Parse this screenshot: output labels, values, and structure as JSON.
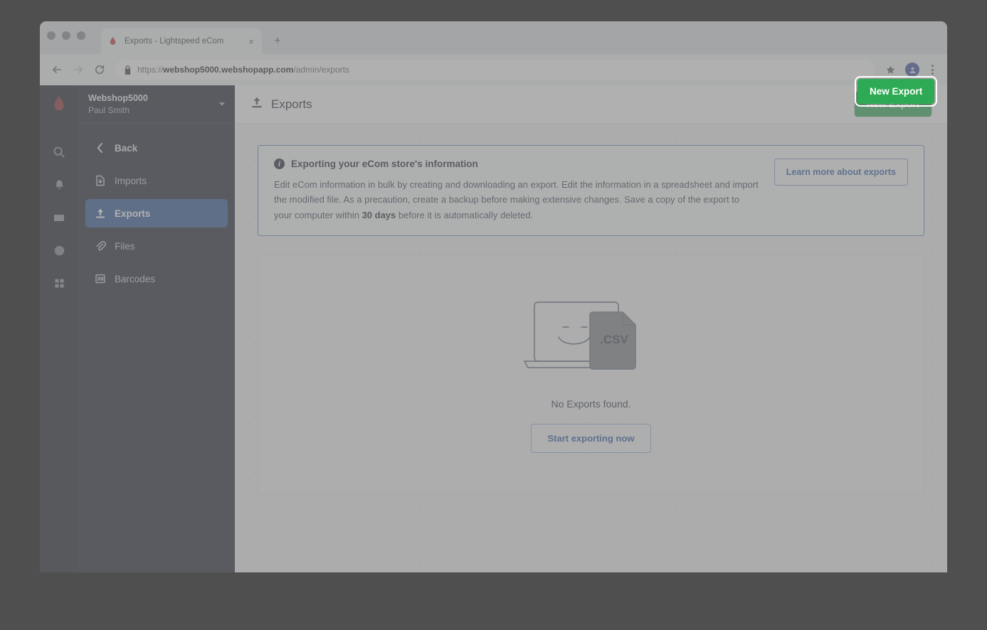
{
  "browser": {
    "window_buttons": [
      "close",
      "minimize",
      "maximize"
    ],
    "tab": {
      "title": "Exports - Lightspeed eCom",
      "favicon_name": "lightspeed-flame-favicon",
      "close_label": "×"
    },
    "new_tab_label": "+",
    "nav": {
      "back_icon": "back-arrow-icon",
      "forward_icon": "forward-arrow-icon",
      "reload_icon": "reload-icon",
      "lock_icon": "lock-icon",
      "extensions_icon": "extensions-icon",
      "profile_icon": "profile-avatar-icon",
      "menu_icon": "three-dot-menu-icon"
    },
    "url": {
      "scheme": "https://",
      "domain": "webshop5000.webshopapp.com",
      "path": "/admin/exports"
    }
  },
  "rail": {
    "logo_name": "lightspeed-logo",
    "items": [
      {
        "name": "search-icon"
      },
      {
        "name": "notifications-bell-icon"
      },
      {
        "name": "inbox-icon"
      },
      {
        "name": "globe-icon"
      },
      {
        "name": "apps-grid-icon"
      }
    ]
  },
  "sidebar": {
    "shop_name": "Webshop5000",
    "user_name": "Paul Smith",
    "dropdown_icon": "chevron-down-icon",
    "items": [
      {
        "label": "Back",
        "icon": "chevron-left-icon",
        "active": false
      },
      {
        "label": "Imports",
        "icon": "import-icon",
        "active": false
      },
      {
        "label": "Exports",
        "icon": "export-icon",
        "active": true
      },
      {
        "label": "Files",
        "icon": "paperclip-icon",
        "active": false
      },
      {
        "label": "Barcodes",
        "icon": "barcode-icon",
        "active": false
      }
    ]
  },
  "header": {
    "title": "Exports",
    "title_icon": "export-icon",
    "new_export_label": "New Export",
    "new_export_color": "#2eaa54"
  },
  "banner": {
    "icon": "info-circle-icon",
    "title": "Exporting your eCom store's information",
    "body_before": "Edit eCom information in bulk by creating and downloading an export. Edit the information in a spreadsheet and import the modified file. As a precaution, create a backup before making extensive changes. Save a copy of the export to your computer within ",
    "body_highlight": "30 days",
    "body_after": " before it is automatically deleted.",
    "learn_more_label": "Learn more about exports",
    "border_color": "#5e87c9"
  },
  "empty_state": {
    "illustration_name": "laptop-csv-illustration",
    "illustration_label": ".CSV",
    "message": "No Exports found.",
    "action_label": "Start exporting now"
  }
}
